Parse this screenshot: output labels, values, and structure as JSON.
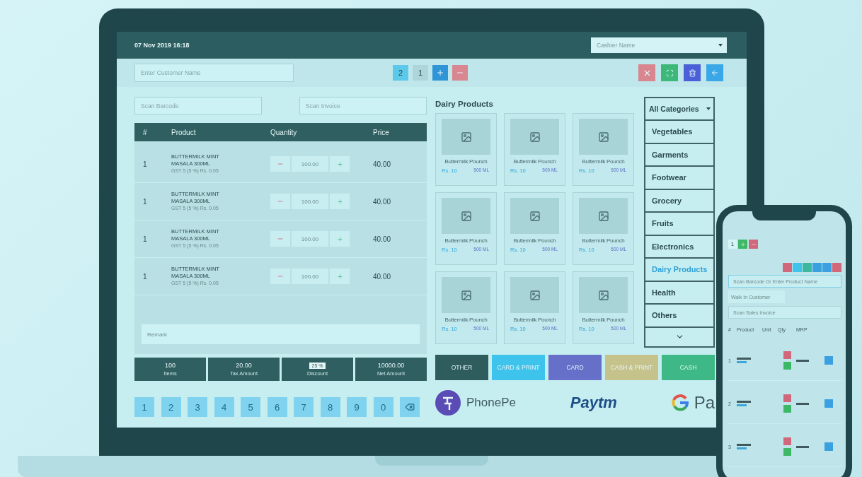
{
  "top_bar": {
    "datetime": "07 Nov 2019 16:18",
    "cashier_select": {
      "placeholder": "Cashier Name"
    }
  },
  "toolbar": {
    "customer_field": {
      "placeholder": "Enter Customer Name"
    },
    "tabs": [
      {
        "label": "2",
        "selected": true
      },
      {
        "label": "1",
        "selected": false
      }
    ],
    "tab_buttons": [
      {
        "kind": "add"
      },
      {
        "kind": "remove"
      }
    ],
    "tool_buttons": [
      {
        "kind": "close"
      },
      {
        "kind": "fullscreen"
      },
      {
        "kind": "delete"
      },
      {
        "kind": "back"
      }
    ]
  },
  "scan_fields": [
    {
      "placeholder": "Scan Barcode"
    },
    {
      "placeholder": "Scan Invoice"
    }
  ],
  "cart": {
    "columns": [
      "#",
      "Product",
      "Quantity",
      "Price"
    ],
    "rows": [
      {
        "index": "1",
        "product": "BUTTERMILK MINT MASALA 300ML",
        "tax": "GST 5 (5 %) Rs. 0.05",
        "quantity": "100.00",
        "price": "40.00"
      },
      {
        "index": "1",
        "product": "BUTTERMILK MINT MASALA 300ML",
        "tax": "GST 5 (5 %) Rs. 0.05",
        "quantity": "100.00",
        "price": "40.00"
      },
      {
        "index": "1",
        "product": "BUTTERMILK MINT MASALA 300ML",
        "tax": "GST 5 (5 %) Rs. 0.05",
        "quantity": "100.00",
        "price": "40.00"
      },
      {
        "index": "1",
        "product": "BUTTERMILK MINT MASALA 300ML",
        "tax": "GST 5 (5 %) Rs. 0.05",
        "quantity": "100.00",
        "price": "40.00"
      }
    ],
    "remark": {
      "placeholder": "Remark"
    }
  },
  "summary": [
    {
      "kind": "text",
      "value": "100",
      "label": "Items"
    },
    {
      "kind": "text",
      "value": "20.00",
      "label": "Tax Amount"
    },
    {
      "kind": "input",
      "value": "25 %",
      "label": "Discount"
    },
    {
      "kind": "text",
      "value": "10000.00",
      "label": "Net Amount"
    }
  ],
  "numpad": [
    "1",
    "2",
    "3",
    "4",
    "5",
    "6",
    "7",
    "8",
    "9",
    "0"
  ],
  "products": {
    "title": "Dairy Products",
    "items": [
      {
        "name": "Buttermilk Pounch",
        "price": "Rs. 10",
        "size": "500 ML"
      },
      {
        "name": "Buttermilk Pounch",
        "price": "Rs. 10",
        "size": "500 ML"
      },
      {
        "name": "Buttermilk Pounch",
        "price": "Rs. 10",
        "size": "500 ML"
      },
      {
        "name": "Buttermilk Pounch",
        "price": "Rs. 10",
        "size": "500 ML"
      },
      {
        "name": "Buttermilk Pounch",
        "price": "Rs. 10",
        "size": "500 ML"
      },
      {
        "name": "Buttermilk Pounch",
        "price": "Rs. 10",
        "size": "500 ML"
      },
      {
        "name": "Buttermilk Pounch",
        "price": "Rs. 10",
        "size": "500 ML"
      },
      {
        "name": "Buttermilk Pounch",
        "price": "Rs. 10",
        "size": "500 ML"
      },
      {
        "name": "Buttermilk Pounch",
        "price": "Rs. 10",
        "size": "500 ML"
      }
    ]
  },
  "categories": {
    "dropdown": "All Categories",
    "items": [
      {
        "label": "Vegetables",
        "selected": false
      },
      {
        "label": "Garments",
        "selected": false
      },
      {
        "label": "Footwear",
        "selected": false
      },
      {
        "label": "Grocery",
        "selected": false
      },
      {
        "label": "Fruits",
        "selected": false
      },
      {
        "label": "Electronics",
        "selected": false
      },
      {
        "label": "Dairy Products",
        "selected": true
      },
      {
        "label": "Health",
        "selected": false
      },
      {
        "label": "Others",
        "selected": false
      }
    ]
  },
  "payment_buttons": [
    {
      "label": "OTHER",
      "color": "#2f5d5e"
    },
    {
      "label": "CARD & PRINT",
      "color": "#3ec4ec"
    },
    {
      "label": "CARD",
      "color": "#6670c8"
    },
    {
      "label": "CASH & PRINT",
      "color": "#c6c28c"
    },
    {
      "label": "CASH",
      "color": "#3db886"
    }
  ],
  "payment_logos": [
    {
      "kind": "phonepe",
      "text": "PhonePe"
    },
    {
      "kind": "paytm",
      "text": "Paytm"
    },
    {
      "kind": "gpay",
      "text": "Pa"
    }
  ],
  "phone": {
    "tab": "1",
    "action_buttons": [
      {
        "color": "#d0677b"
      },
      {
        "color": "#3ec4ec"
      },
      {
        "color": "#3db8a0"
      },
      {
        "color": "#3aa0e0"
      },
      {
        "color": "#3aa0e0"
      },
      {
        "color": "#d0677b"
      }
    ],
    "product_field": {
      "placeholder": "Scan Barcode Or Enter Product Name"
    },
    "customer_tab": "Walk In Customer",
    "invoice_field": {
      "placeholder": "Scan Sales Invoice"
    },
    "columns": [
      "#",
      "Product",
      "Unit",
      "Qty",
      "MRP"
    ],
    "rows": [
      {
        "index": "1"
      },
      {
        "index": "2"
      },
      {
        "index": "3"
      }
    ]
  }
}
